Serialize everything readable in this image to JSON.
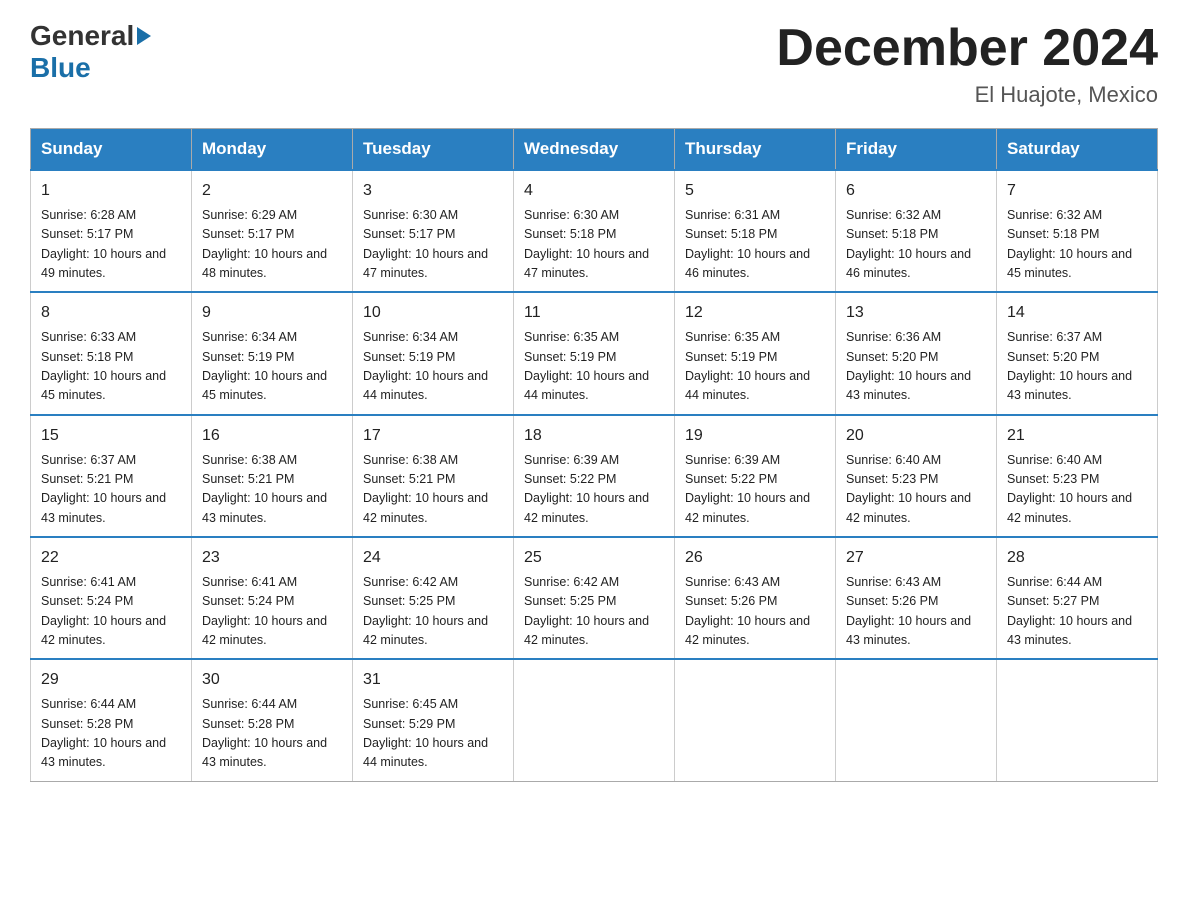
{
  "header": {
    "logo_general": "General",
    "logo_blue": "Blue",
    "month_title": "December 2024",
    "location": "El Huajote, Mexico"
  },
  "days_of_week": [
    "Sunday",
    "Monday",
    "Tuesday",
    "Wednesday",
    "Thursday",
    "Friday",
    "Saturday"
  ],
  "weeks": [
    [
      {
        "day": "1",
        "sunrise": "6:28 AM",
        "sunset": "5:17 PM",
        "daylight": "10 hours and 49 minutes."
      },
      {
        "day": "2",
        "sunrise": "6:29 AM",
        "sunset": "5:17 PM",
        "daylight": "10 hours and 48 minutes."
      },
      {
        "day": "3",
        "sunrise": "6:30 AM",
        "sunset": "5:17 PM",
        "daylight": "10 hours and 47 minutes."
      },
      {
        "day": "4",
        "sunrise": "6:30 AM",
        "sunset": "5:18 PM",
        "daylight": "10 hours and 47 minutes."
      },
      {
        "day": "5",
        "sunrise": "6:31 AM",
        "sunset": "5:18 PM",
        "daylight": "10 hours and 46 minutes."
      },
      {
        "day": "6",
        "sunrise": "6:32 AM",
        "sunset": "5:18 PM",
        "daylight": "10 hours and 46 minutes."
      },
      {
        "day": "7",
        "sunrise": "6:32 AM",
        "sunset": "5:18 PM",
        "daylight": "10 hours and 45 minutes."
      }
    ],
    [
      {
        "day": "8",
        "sunrise": "6:33 AM",
        "sunset": "5:18 PM",
        "daylight": "10 hours and 45 minutes."
      },
      {
        "day": "9",
        "sunrise": "6:34 AM",
        "sunset": "5:19 PM",
        "daylight": "10 hours and 45 minutes."
      },
      {
        "day": "10",
        "sunrise": "6:34 AM",
        "sunset": "5:19 PM",
        "daylight": "10 hours and 44 minutes."
      },
      {
        "day": "11",
        "sunrise": "6:35 AM",
        "sunset": "5:19 PM",
        "daylight": "10 hours and 44 minutes."
      },
      {
        "day": "12",
        "sunrise": "6:35 AM",
        "sunset": "5:19 PM",
        "daylight": "10 hours and 44 minutes."
      },
      {
        "day": "13",
        "sunrise": "6:36 AM",
        "sunset": "5:20 PM",
        "daylight": "10 hours and 43 minutes."
      },
      {
        "day": "14",
        "sunrise": "6:37 AM",
        "sunset": "5:20 PM",
        "daylight": "10 hours and 43 minutes."
      }
    ],
    [
      {
        "day": "15",
        "sunrise": "6:37 AM",
        "sunset": "5:21 PM",
        "daylight": "10 hours and 43 minutes."
      },
      {
        "day": "16",
        "sunrise": "6:38 AM",
        "sunset": "5:21 PM",
        "daylight": "10 hours and 43 minutes."
      },
      {
        "day": "17",
        "sunrise": "6:38 AM",
        "sunset": "5:21 PM",
        "daylight": "10 hours and 42 minutes."
      },
      {
        "day": "18",
        "sunrise": "6:39 AM",
        "sunset": "5:22 PM",
        "daylight": "10 hours and 42 minutes."
      },
      {
        "day": "19",
        "sunrise": "6:39 AM",
        "sunset": "5:22 PM",
        "daylight": "10 hours and 42 minutes."
      },
      {
        "day": "20",
        "sunrise": "6:40 AM",
        "sunset": "5:23 PM",
        "daylight": "10 hours and 42 minutes."
      },
      {
        "day": "21",
        "sunrise": "6:40 AM",
        "sunset": "5:23 PM",
        "daylight": "10 hours and 42 minutes."
      }
    ],
    [
      {
        "day": "22",
        "sunrise": "6:41 AM",
        "sunset": "5:24 PM",
        "daylight": "10 hours and 42 minutes."
      },
      {
        "day": "23",
        "sunrise": "6:41 AM",
        "sunset": "5:24 PM",
        "daylight": "10 hours and 42 minutes."
      },
      {
        "day": "24",
        "sunrise": "6:42 AM",
        "sunset": "5:25 PM",
        "daylight": "10 hours and 42 minutes."
      },
      {
        "day": "25",
        "sunrise": "6:42 AM",
        "sunset": "5:25 PM",
        "daylight": "10 hours and 42 minutes."
      },
      {
        "day": "26",
        "sunrise": "6:43 AM",
        "sunset": "5:26 PM",
        "daylight": "10 hours and 42 minutes."
      },
      {
        "day": "27",
        "sunrise": "6:43 AM",
        "sunset": "5:26 PM",
        "daylight": "10 hours and 43 minutes."
      },
      {
        "day": "28",
        "sunrise": "6:44 AM",
        "sunset": "5:27 PM",
        "daylight": "10 hours and 43 minutes."
      }
    ],
    [
      {
        "day": "29",
        "sunrise": "6:44 AM",
        "sunset": "5:28 PM",
        "daylight": "10 hours and 43 minutes."
      },
      {
        "day": "30",
        "sunrise": "6:44 AM",
        "sunset": "5:28 PM",
        "daylight": "10 hours and 43 minutes."
      },
      {
        "day": "31",
        "sunrise": "6:45 AM",
        "sunset": "5:29 PM",
        "daylight": "10 hours and 44 minutes."
      },
      null,
      null,
      null,
      null
    ]
  ]
}
